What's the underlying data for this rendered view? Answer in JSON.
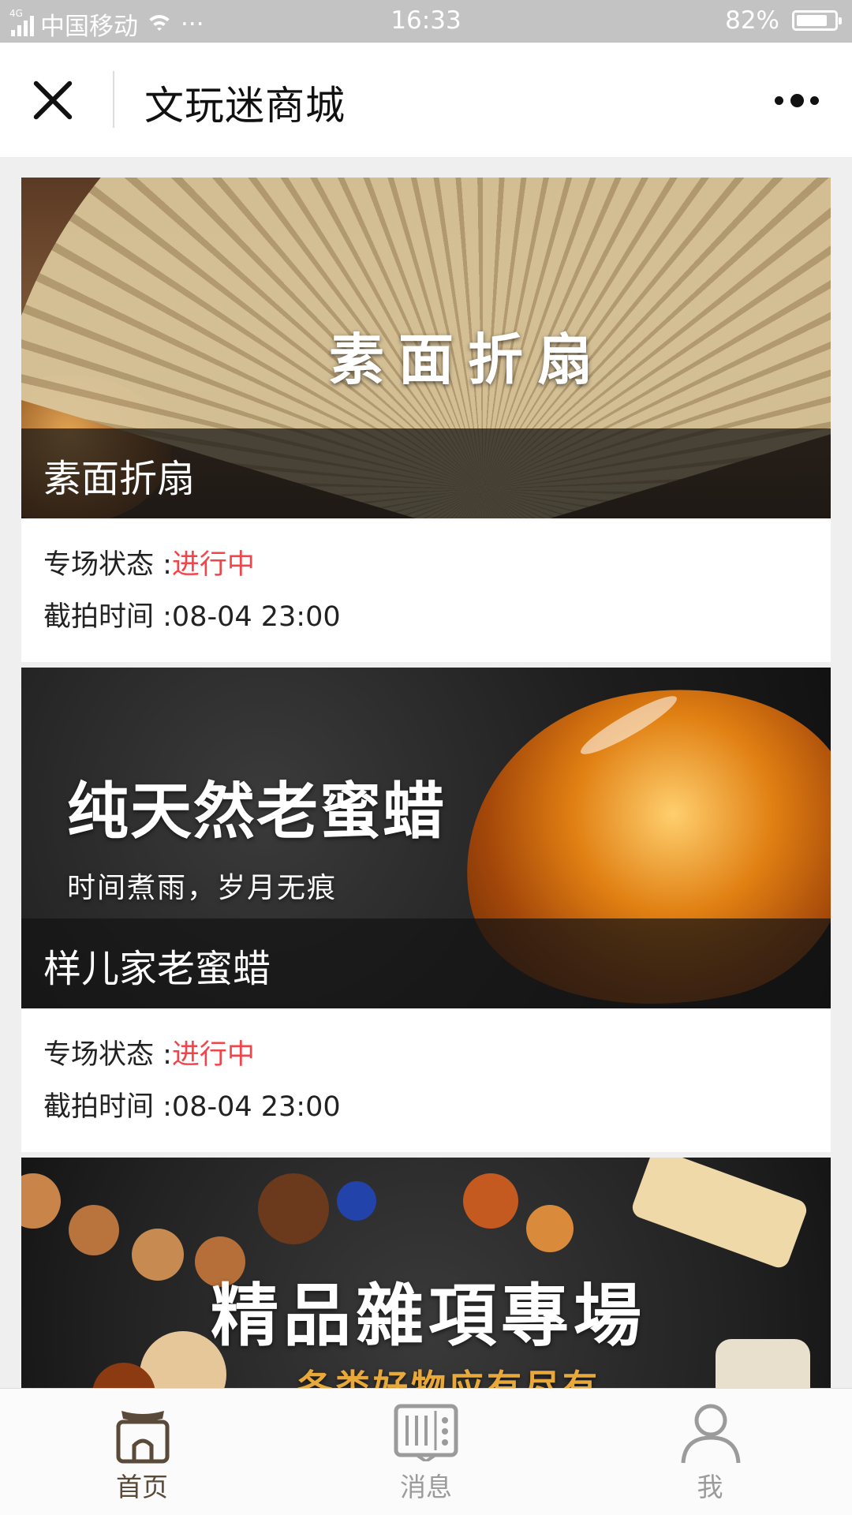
{
  "status_bar": {
    "network": "4G",
    "carrier": "中国移动",
    "dots": "···",
    "time": "16:33",
    "battery": "82%",
    "battery_level": 0.82
  },
  "nav": {
    "title": "文玩迷商城"
  },
  "cards": [
    {
      "banner_text": "素面折扇",
      "caption": "素面折扇",
      "status_label": "专场状态 :",
      "status_value": "进行中",
      "time_label": "截拍时间 :",
      "time_value": "08-04 23:00"
    },
    {
      "banner_text": "纯天然老蜜蜡",
      "banner_subtext": "时间煮雨，岁月无痕",
      "caption": "样儿家老蜜蜡",
      "status_label": "专场状态 :",
      "status_value": "进行中",
      "time_label": "截拍时间 :",
      "time_value": "08-04 23:00"
    },
    {
      "banner_text": "精品雜項專場",
      "banner_subtext": "各类好物应有尽有"
    }
  ],
  "tabs": [
    {
      "label": "首页",
      "icon": "home-icon",
      "active": true
    },
    {
      "label": "消息",
      "icon": "message-icon",
      "active": false
    },
    {
      "label": "我",
      "icon": "profile-icon",
      "active": false
    }
  ],
  "colors": {
    "status_active": "#f2444a",
    "tab_active": "#5a4a3a",
    "tab_inactive": "#9b9b9b"
  }
}
